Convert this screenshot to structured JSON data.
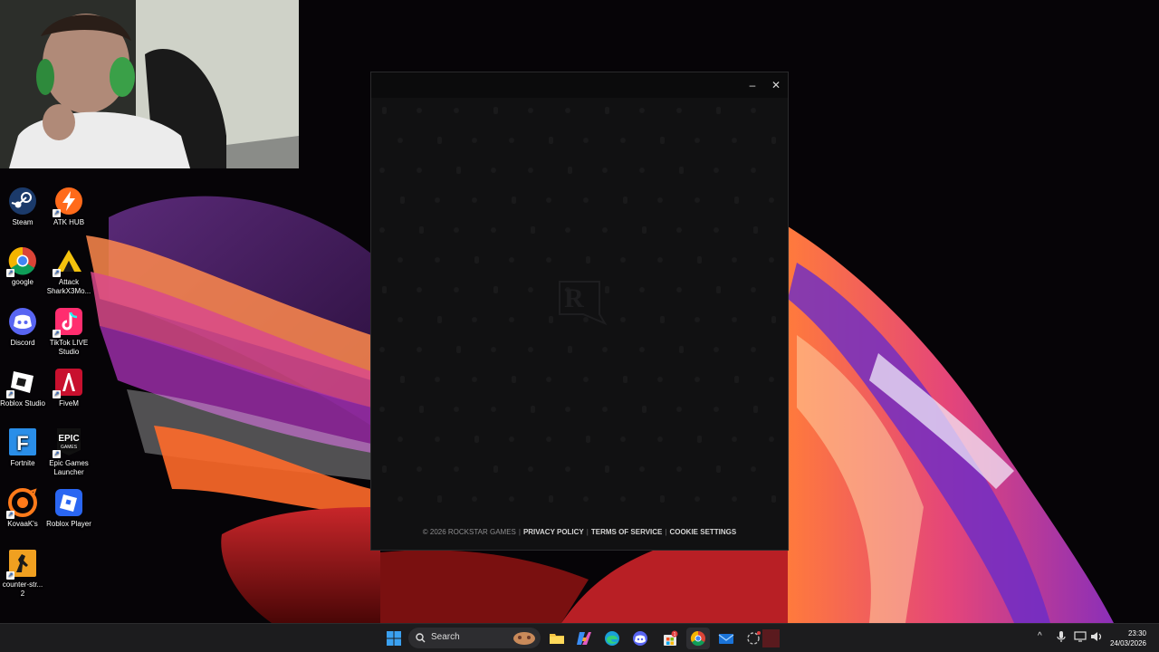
{
  "desktop_icons": [
    {
      "id": "steam",
      "label": "Steam",
      "icon": "steam-icon"
    },
    {
      "id": "atk-hub",
      "label": "ATK HUB",
      "icon": "atk-hub-icon"
    },
    {
      "id": "google",
      "label": "google",
      "icon": "chrome-icon"
    },
    {
      "id": "attack-shark",
      "label": "Attack SharkX3Mo...",
      "icon": "attack-shark-icon"
    },
    {
      "id": "discord",
      "label": "Discord",
      "icon": "discord-icon"
    },
    {
      "id": "tiktok-live",
      "label": "TikTok LIVE Studio",
      "icon": "tiktok-icon"
    },
    {
      "id": "roblox-studio",
      "label": "Roblox Studio",
      "icon": "roblox-studio-icon"
    },
    {
      "id": "fivem",
      "label": "FiveM",
      "icon": "fivem-icon"
    },
    {
      "id": "fortnite",
      "label": "Fortnite",
      "icon": "fortnite-icon"
    },
    {
      "id": "epic",
      "label": "Epic Games Launcher",
      "icon": "epic-games-icon"
    },
    {
      "id": "kovaaks",
      "label": "KovaaK's",
      "icon": "kovaaks-icon"
    },
    {
      "id": "roblox-player",
      "label": "Roblox Player",
      "icon": "roblox-player-icon"
    },
    {
      "id": "counter-strike",
      "label": "counter-str... 2",
      "icon": "counter-strike-icon"
    }
  ],
  "icon_glyphs": {
    "epic": "EPIC",
    "epic_sub": "GAMES",
    "fortnite": "F",
    "logo": "R"
  },
  "launcher": {
    "minimize_glyph": "–",
    "close_glyph": "✕",
    "footer": {
      "copyright": "© 2026 ROCKSTAR GAMES",
      "privacy": "PRIVACY POLICY",
      "terms": "TERMS OF SERVICE",
      "cookies": "COOKIE SETTINGS",
      "separator": "|"
    }
  },
  "taskbar": {
    "search_label": "Search",
    "time": "23:30",
    "date": "24/03/2026",
    "tray_chevron": "^",
    "badge_count": "1"
  },
  "colors": {
    "launcher_bg": "#111112",
    "taskbar_bg": "#1c1c1e",
    "accent": "#0078d4"
  }
}
